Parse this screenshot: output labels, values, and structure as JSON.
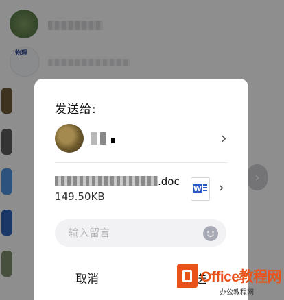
{
  "dialog": {
    "title": "发送给:",
    "file": {
      "name_suffix": ".doc",
      "size": "149.50KB"
    },
    "message_input": {
      "placeholder": "输入留言",
      "value": ""
    },
    "cancel_label": "取消",
    "send_label": "送"
  },
  "background": {
    "chat_sub_label": "物理",
    "edge_button_icon": "chevron-right-icon"
  },
  "watermark": {
    "brand": "Office教程网",
    "sub": "办公教程网"
  },
  "colors": {
    "accent_orange": "#e9531a",
    "word_blue": "#2b5cc4",
    "scrim": "rgba(0,0,0,0.42)"
  }
}
